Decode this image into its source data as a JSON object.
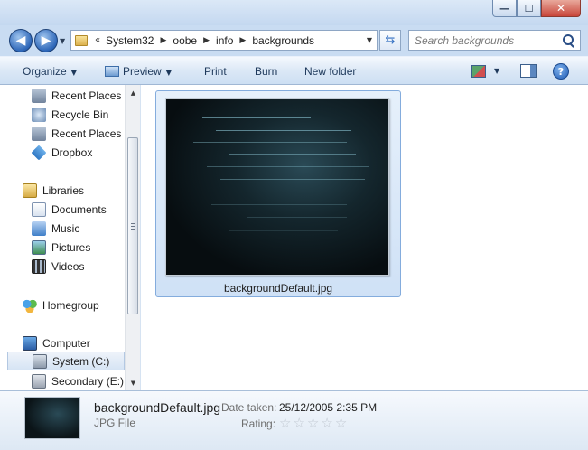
{
  "window": {
    "caption_buttons": [
      {
        "name": "minimize-button",
        "glyph": "—"
      },
      {
        "name": "maximize-button",
        "glyph": "☐"
      },
      {
        "name": "close-button",
        "glyph": "✕"
      }
    ]
  },
  "navigation": {
    "back_icon": "arrow-left-icon",
    "forward_icon": "arrow-right-icon",
    "back_glyph": "◀",
    "forward_glyph": "▶",
    "recent_dropdown_glyph": "▼"
  },
  "address_bar": {
    "overflow_chevron": "«",
    "breadcrumbs": [
      "System32",
      "oobe",
      "info",
      "backgrounds"
    ],
    "separator_glyph": "▶",
    "dropdown_glyph": "▼",
    "refresh_glyph": "⇆"
  },
  "search": {
    "placeholder": "Search backgrounds"
  },
  "toolbar": {
    "organize_label": "Organize",
    "preview_label": "Preview",
    "print_label": "Print",
    "burn_label": "Burn",
    "new_folder_label": "New folder",
    "dropdown_glyph": "▼",
    "help_glyph": "?"
  },
  "nav_pane": {
    "items": [
      {
        "label": "Recent Places",
        "icon": "recent-places-icon"
      },
      {
        "label": "Recycle Bin",
        "icon": "recycle-bin-icon"
      },
      {
        "label": "Recent Places",
        "icon": "recent-places-icon"
      },
      {
        "label": "Dropbox",
        "icon": "dropbox-icon"
      },
      {
        "label": "Libraries",
        "icon": "libraries-icon"
      },
      {
        "label": "Documents",
        "icon": "documents-icon"
      },
      {
        "label": "Music",
        "icon": "music-icon"
      },
      {
        "label": "Pictures",
        "icon": "pictures-icon"
      },
      {
        "label": "Videos",
        "icon": "videos-icon"
      },
      {
        "label": "Homegroup",
        "icon": "homegroup-icon"
      },
      {
        "label": "Computer",
        "icon": "computer-icon"
      },
      {
        "label": "System (C:)",
        "icon": "drive-icon",
        "selected": true
      },
      {
        "label": "Secondary (E:)",
        "icon": "drive-icon"
      }
    ],
    "scroll_up_glyph": "▲",
    "scroll_down_glyph": "▼"
  },
  "content": {
    "files": [
      {
        "name": "backgroundDefault.jpg",
        "selected": true
      }
    ]
  },
  "details_pane": {
    "file_name": "backgroundDefault.jpg",
    "file_type": "JPG File",
    "date_taken_label": "Date taken:",
    "date_taken_value": "25/12/2005 2:35 PM",
    "rating_label": "Rating:",
    "rating_value": 0,
    "rating_max": 5,
    "star_glyph": "☆"
  },
  "colors": {
    "accent": "#2d66b8",
    "selection_border": "#84acdd",
    "selection_fill": "#d6e6f8"
  }
}
